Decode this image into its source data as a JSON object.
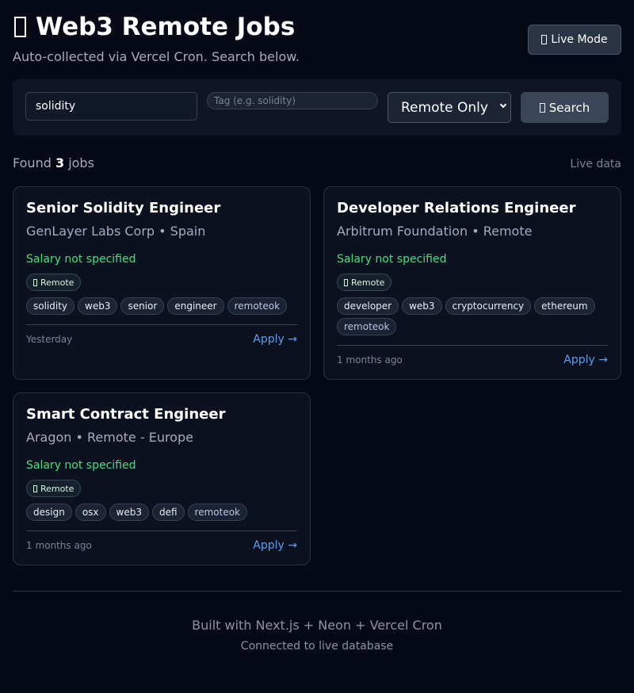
{
  "header": {
    "title": "Web3 Remote Jobs",
    "title_icon": "rocket-icon",
    "subtitle": "Auto-collected via Vercel Cron. Search below.",
    "live_mode_label": "Live Mode",
    "live_mode_icon": "live-icon"
  },
  "search": {
    "keyword_value": "solidity",
    "tag_placeholder": "Tag (e.g. solidity)",
    "location_selected": "Remote Only",
    "button_label": "Search",
    "button_icon": "search-icon"
  },
  "results": {
    "found_prefix": "Found",
    "count": "3",
    "found_suffix": "jobs",
    "source_label": "Live data"
  },
  "jobs": [
    {
      "title": "Senior Solidity Engineer",
      "company_location": "GenLayer Labs Corp • Spain",
      "salary": "Salary not specified",
      "remote_badge": "Remote",
      "tags": [
        "solidity",
        "web3",
        "senior",
        "engineer"
      ],
      "source_tag": "remoteok",
      "date": "Yesterday",
      "apply": "Apply →"
    },
    {
      "title": "Developer Relations Engineer",
      "company_location": "Arbitrum Foundation • Remote",
      "salary": "Salary not specified",
      "remote_badge": "Remote",
      "tags": [
        "developer",
        "web3",
        "cryptocurrency",
        "ethereum"
      ],
      "source_tag": "remoteok",
      "date": "1 months ago",
      "apply": "Apply →"
    },
    {
      "title": "Smart Contract Engineer",
      "company_location": "Aragon • Remote - Europe",
      "salary": "Salary not specified",
      "remote_badge": "Remote",
      "tags": [
        "design",
        "osx",
        "web3",
        "defi"
      ],
      "source_tag": "remoteok",
      "date": "1 months ago",
      "apply": "Apply →"
    }
  ],
  "footer": {
    "built_with": "Built with Next.js + Neon + Vercel Cron",
    "connection": "Connected to live database"
  },
  "colors": {
    "background": "#060a16",
    "salary": "#4ade80",
    "apply_link": "#5c9ef0"
  }
}
